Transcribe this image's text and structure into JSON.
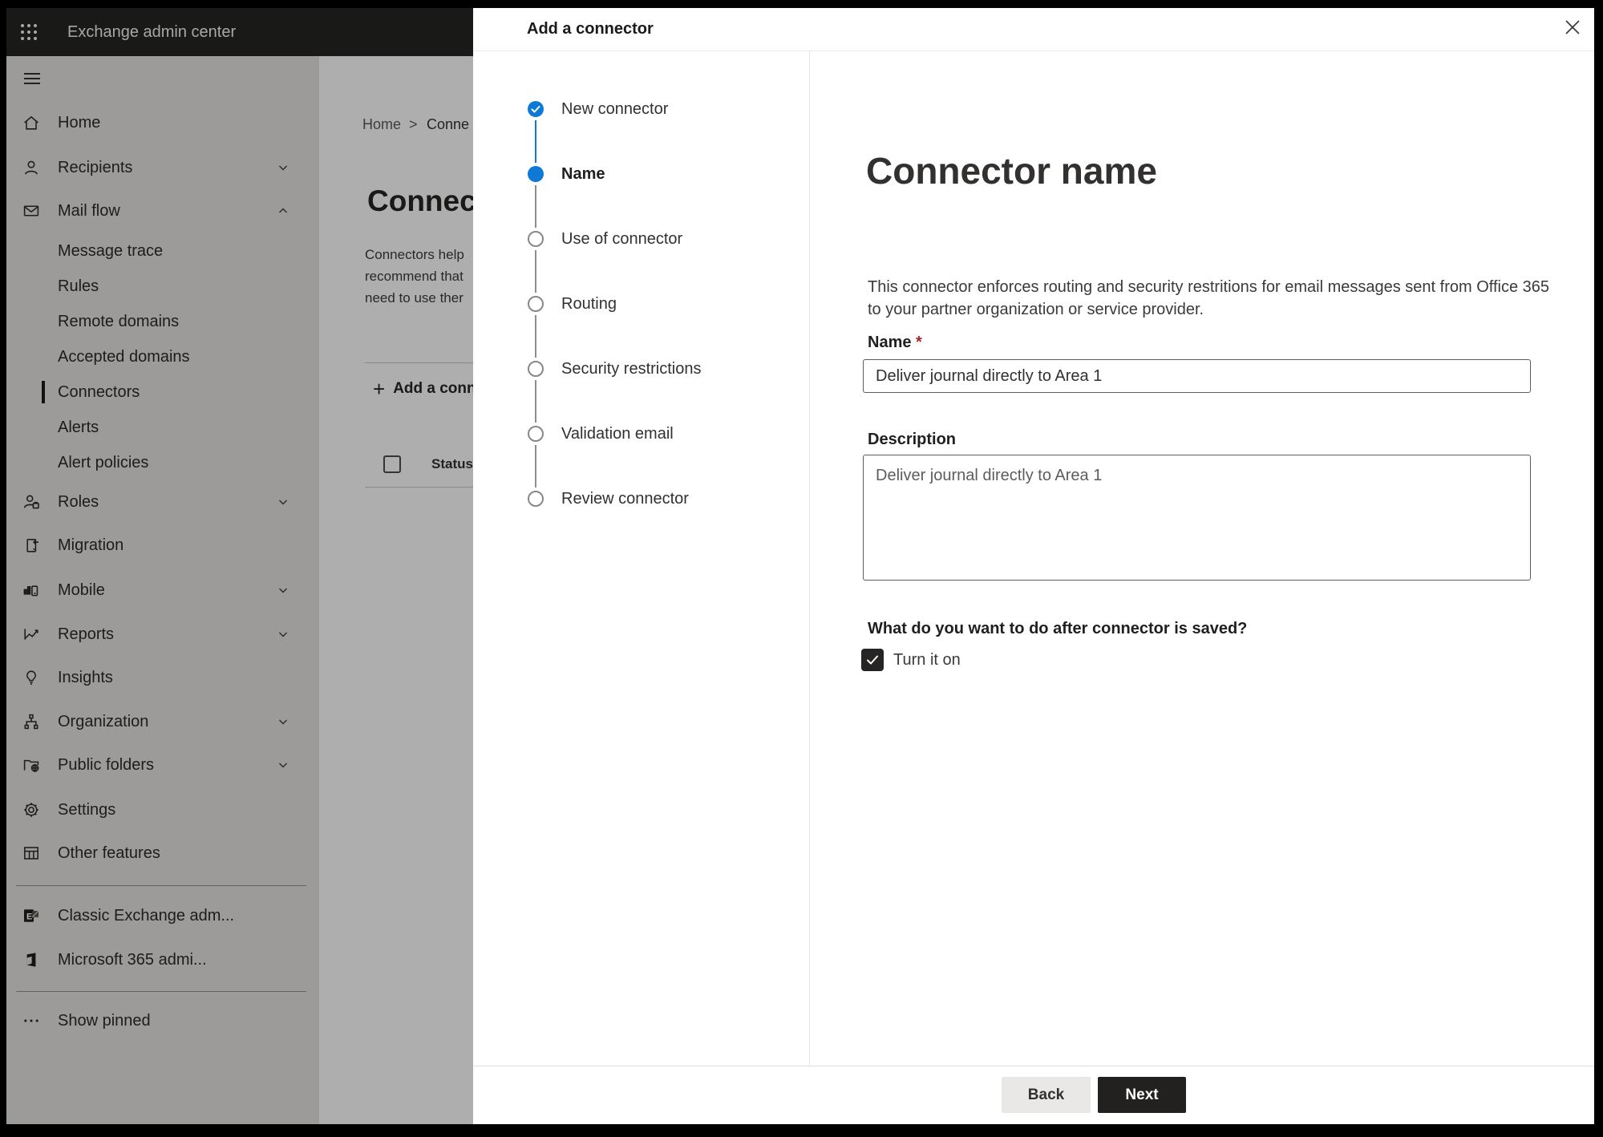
{
  "app": {
    "title": "Exchange admin center"
  },
  "colors": {
    "accent_blue": "#0f7ad6",
    "topbar_bg": "#252423",
    "required_red": "#a4262c",
    "next_button_bg": "#222120",
    "back_button_bg": "#e9e8e7"
  },
  "sidebar": {
    "items": [
      {
        "label": "Home",
        "icon": "home-icon"
      },
      {
        "label": "Recipients",
        "icon": "person-icon",
        "chevron": "down"
      },
      {
        "label": "Mail flow",
        "icon": "mail-icon",
        "chevron": "up",
        "expanded": true
      },
      {
        "label": "Message trace"
      },
      {
        "label": "Rules"
      },
      {
        "label": "Remote domains"
      },
      {
        "label": "Accepted domains"
      },
      {
        "label": "Connectors",
        "selected": true
      },
      {
        "label": "Alerts"
      },
      {
        "label": "Alert policies"
      },
      {
        "label": "Roles",
        "icon": "roles-icon",
        "chevron": "down"
      },
      {
        "label": "Migration",
        "icon": "migration-icon"
      },
      {
        "label": "Mobile",
        "icon": "mobile-icon",
        "chevron": "down"
      },
      {
        "label": "Reports",
        "icon": "reports-icon",
        "chevron": "down"
      },
      {
        "label": "Insights",
        "icon": "lightbulb-icon"
      },
      {
        "label": "Organization",
        "icon": "org-chart-icon",
        "chevron": "down"
      },
      {
        "label": "Public folders",
        "icon": "folder-globe-icon",
        "chevron": "down"
      },
      {
        "label": "Settings",
        "icon": "gear-icon"
      },
      {
        "label": "Other features",
        "icon": "table-icon"
      },
      {
        "label": "Classic Exchange adm...",
        "icon": "exchange-logo-icon"
      },
      {
        "label": "Microsoft 365 admi...",
        "icon": "m365-logo-icon"
      },
      {
        "label": "Show pinned",
        "icon": "ellipsis-icon"
      }
    ]
  },
  "page": {
    "breadcrumb": {
      "home": "Home",
      "separator": ">",
      "current": "Conne"
    },
    "heading": "Connec",
    "description_lines": [
      "Connectors help",
      "recommend that",
      "need to use ther"
    ],
    "add_button": "Add a conn",
    "add_icon": "+",
    "list_header": {
      "status": "Status"
    }
  },
  "dialog": {
    "title": "Add a connector",
    "close_icon": "close-icon",
    "steps": [
      {
        "label": "New connector",
        "state": "completed"
      },
      {
        "label": "Name",
        "state": "current"
      },
      {
        "label": "Use of connector",
        "state": "upcoming"
      },
      {
        "label": "Routing",
        "state": "upcoming"
      },
      {
        "label": "Security restrictions",
        "state": "upcoming"
      },
      {
        "label": "Validation email",
        "state": "upcoming"
      },
      {
        "label": "Review connector",
        "state": "upcoming"
      }
    ],
    "content": {
      "title": "Connector name",
      "description": "This connector enforces routing and security restritions for email messages sent from Office 365 to your partner organization or service provider.",
      "name_label": "Name",
      "required_marker": "*",
      "name_value": "Deliver journal directly to Area 1",
      "description_label": "Description",
      "description_value": "Deliver journal directly to Area 1",
      "question": "What do you want to do after connector is saved?",
      "checkbox_label": "Turn it on",
      "checkbox_checked": true
    },
    "footer": {
      "back": "Back",
      "next": "Next"
    }
  }
}
